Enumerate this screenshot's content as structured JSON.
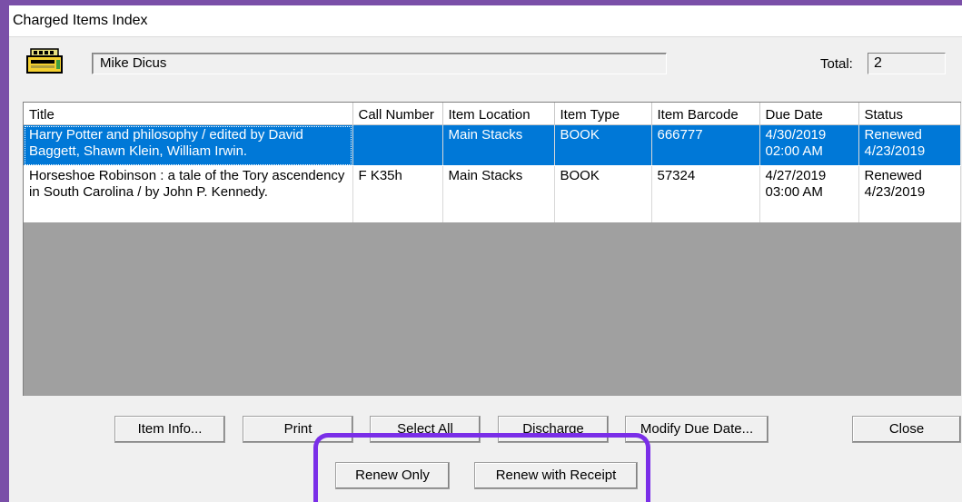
{
  "window": {
    "title": "Charged Items Index"
  },
  "patron": {
    "name": "Mike Dicus",
    "icon": "patron-record-icon"
  },
  "total": {
    "label": "Total:",
    "value": "2"
  },
  "table": {
    "columns": [
      "Title",
      "Call Number",
      "Item Location",
      "Item Type",
      "Item Barcode",
      "Due Date",
      "Status"
    ],
    "rows": [
      {
        "title": "Harry Potter and philosophy / edited by David Baggett, Shawn Klein, William Irwin.",
        "call_number": "",
        "location": "Main Stacks",
        "type": "BOOK",
        "barcode": "666777",
        "due_date": "4/30/2019",
        "due_time": "02:00 AM",
        "status": "Renewed",
        "status_date": "4/23/2019",
        "selected": true
      },
      {
        "title": "Horseshoe Robinson : a tale of the Tory ascendency in South Carolina / by John P. Kennedy.",
        "call_number": "F K35h",
        "location": "Main Stacks",
        "type": "BOOK",
        "barcode": "57324",
        "due_date": "4/27/2019",
        "due_time": "03:00 AM",
        "status": "Renewed",
        "status_date": "4/23/2019",
        "selected": false
      }
    ]
  },
  "buttons": {
    "item_info": "Item Info...",
    "print": "Print",
    "select_all": "Select All",
    "discharge": "Discharge",
    "modify_due_date": "Modify Due Date...",
    "close": "Close",
    "renew_only": "Renew Only",
    "renew_with_receipt": "Renew with Receipt"
  },
  "colors": {
    "selection": "#0078d7",
    "highlight_outline": "#7a2ee8",
    "window_frame": "#7a4fa8",
    "grid_background": "#a0a0a0"
  }
}
